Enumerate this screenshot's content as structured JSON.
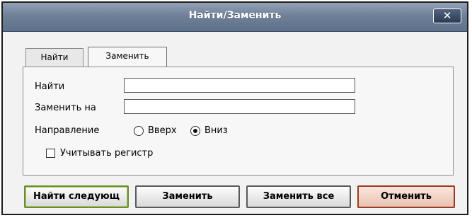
{
  "window": {
    "title": "Найти/Заменить",
    "close_glyph": "✕"
  },
  "tabs": [
    {
      "label": "Найти",
      "active": false
    },
    {
      "label": "Заменить",
      "active": true
    }
  ],
  "form": {
    "find_label": "Найти",
    "find_value": "",
    "replace_label": "Заменить на",
    "replace_value": "",
    "direction_label": "Направление",
    "direction_options": [
      {
        "label": "Вверх",
        "checked": false
      },
      {
        "label": "Вниз",
        "checked": true
      }
    ],
    "match_case_label": "Учитывать регистр",
    "match_case_checked": false
  },
  "buttons": {
    "find_next": "Найти следующ",
    "replace": "Заменить",
    "replace_all": "Заменить все",
    "cancel": "Отменить"
  },
  "colors": {
    "titlebar": "#6f8098",
    "primary_border": "#6b8d2f",
    "cancel_border": "#9b3a1e"
  },
  "icons": {
    "close": "close-icon"
  }
}
